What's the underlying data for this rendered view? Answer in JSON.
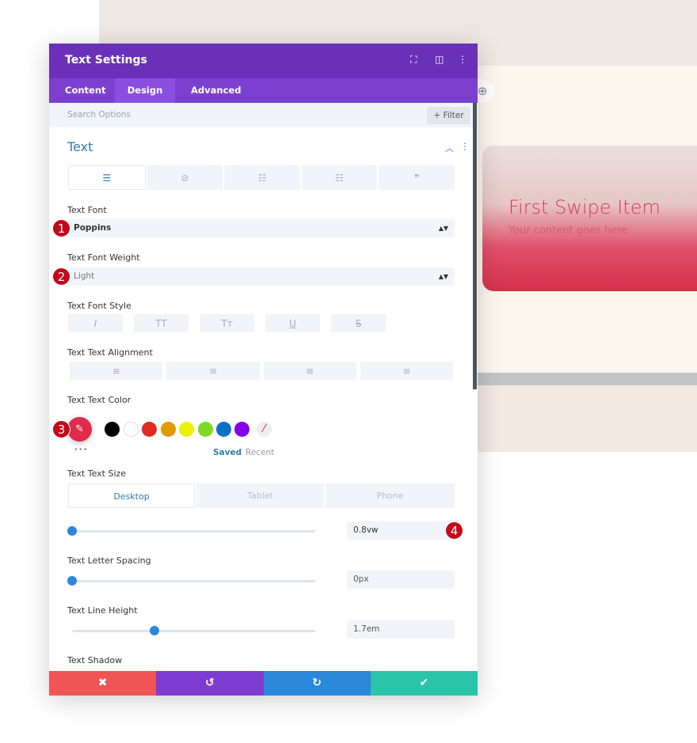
{
  "preview": {
    "title": "First Swipe Item",
    "subtitle": "Your content goes here"
  },
  "header": {
    "title": "Text Settings"
  },
  "tabs": [
    {
      "label": "Content"
    },
    {
      "label": "Design"
    },
    {
      "label": "Advanced"
    }
  ],
  "search": {
    "placeholder": "Search Options",
    "filter_label": "+ Filter"
  },
  "section": {
    "title": "Text"
  },
  "fields": {
    "font_label": "Text Font",
    "font_value": "Poppins",
    "weight_label": "Text Font Weight",
    "weight_value": "Light",
    "style_label": "Text Font Style",
    "align_label": "Text Text Alignment",
    "color_label": "Text Text Color",
    "saved": "Saved",
    "recent": "Recent",
    "size_label": "Text Text Size",
    "size_value": "0.8vw",
    "spacing_label": "Text Letter Spacing",
    "spacing_value": "0px",
    "line_label": "Text Line Height",
    "line_value": "1.7em",
    "shadow_label": "Text Shadow"
  },
  "devices": [
    "Desktop",
    "Tablet",
    "Phone"
  ],
  "sliders": {
    "size_fraction": 0,
    "spacing_fraction": 0,
    "line_fraction": 0.34
  },
  "badges": [
    "1",
    "2",
    "3",
    "4"
  ],
  "colors": {
    "selected": "#e02b4b",
    "swatches": [
      "#000000",
      "#ffffff",
      "#e02b20",
      "#e09900",
      "#edf000",
      "#7cda24",
      "#0c71c3",
      "#8300e9"
    ],
    "header": "#6a31b8",
    "tabs": "#7b40cf",
    "accent": "#2b87da"
  },
  "footer": {
    "cancel": "✖",
    "undo": "↺",
    "redo": "↻",
    "save": "✔"
  }
}
